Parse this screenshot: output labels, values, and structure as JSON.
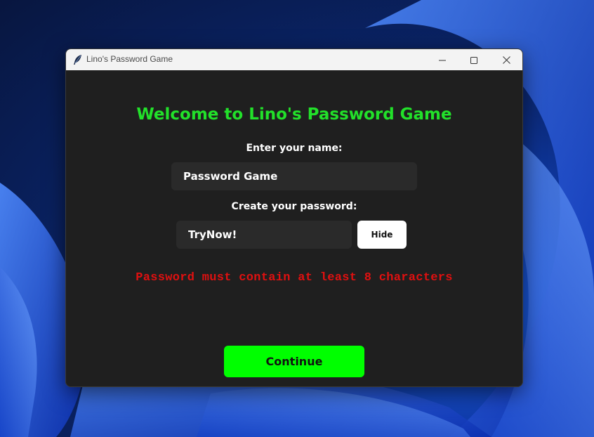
{
  "window": {
    "title": "Lino's Password Game",
    "icon": "feather-icon",
    "controls": {
      "minimize": "minimize-icon",
      "maximize": "maximize-icon",
      "close": "close-icon"
    }
  },
  "main": {
    "heading": "Welcome to Lino's Password Game",
    "name_label": "Enter your name:",
    "name_value": "Password Game",
    "password_label": "Create your password:",
    "password_value": "TryNow!",
    "hide_label": "Hide",
    "error_message": "Password must contain at least 8 characters",
    "continue_label": "Continue"
  },
  "colors": {
    "heading": "#22e12a",
    "error": "#e01010",
    "continue_bg": "#00ff00",
    "window_bg": "#1f1f1f",
    "field_bg": "#2a2a2a"
  }
}
